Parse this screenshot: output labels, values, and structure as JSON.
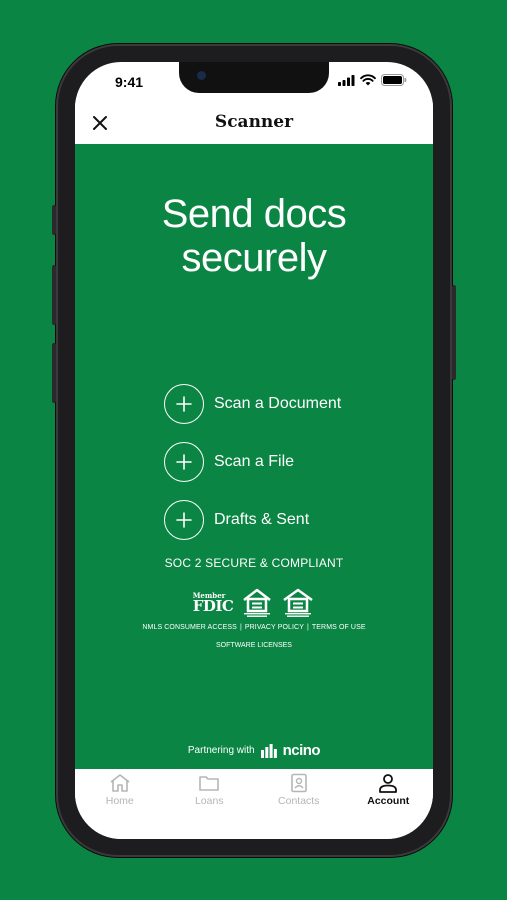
{
  "status_bar": {
    "time": "9:41"
  },
  "nav": {
    "title": "Scanner"
  },
  "headline": {
    "line1": "Send docs",
    "line2": "securely"
  },
  "actions": [
    {
      "label": "Scan a Document"
    },
    {
      "label": "Scan a File"
    },
    {
      "label": "Drafts & Sent"
    }
  ],
  "compliance": {
    "soc": "SOC 2 SECURE & COMPLIANT",
    "fdic_member": "Member",
    "fdic": "FDIC",
    "links": [
      "NMLS CONSUMER ACCESS",
      "PRIVACY POLICY",
      "TERMS OF USE"
    ],
    "software_licenses": "SOFTWARE LICENSES"
  },
  "partner": {
    "text": "Partnering with",
    "brand": "ncino"
  },
  "tabs": [
    {
      "label": "Home",
      "icon": "home-icon",
      "active": false
    },
    {
      "label": "Loans",
      "icon": "folder-icon",
      "active": false
    },
    {
      "label": "Contacts",
      "icon": "contacts-icon",
      "active": false
    },
    {
      "label": "Account",
      "icon": "account-icon",
      "active": true
    }
  ],
  "colors": {
    "brand_green": "#0b8544",
    "white": "#ffffff",
    "inactive_gray": "#b5b5b5"
  }
}
